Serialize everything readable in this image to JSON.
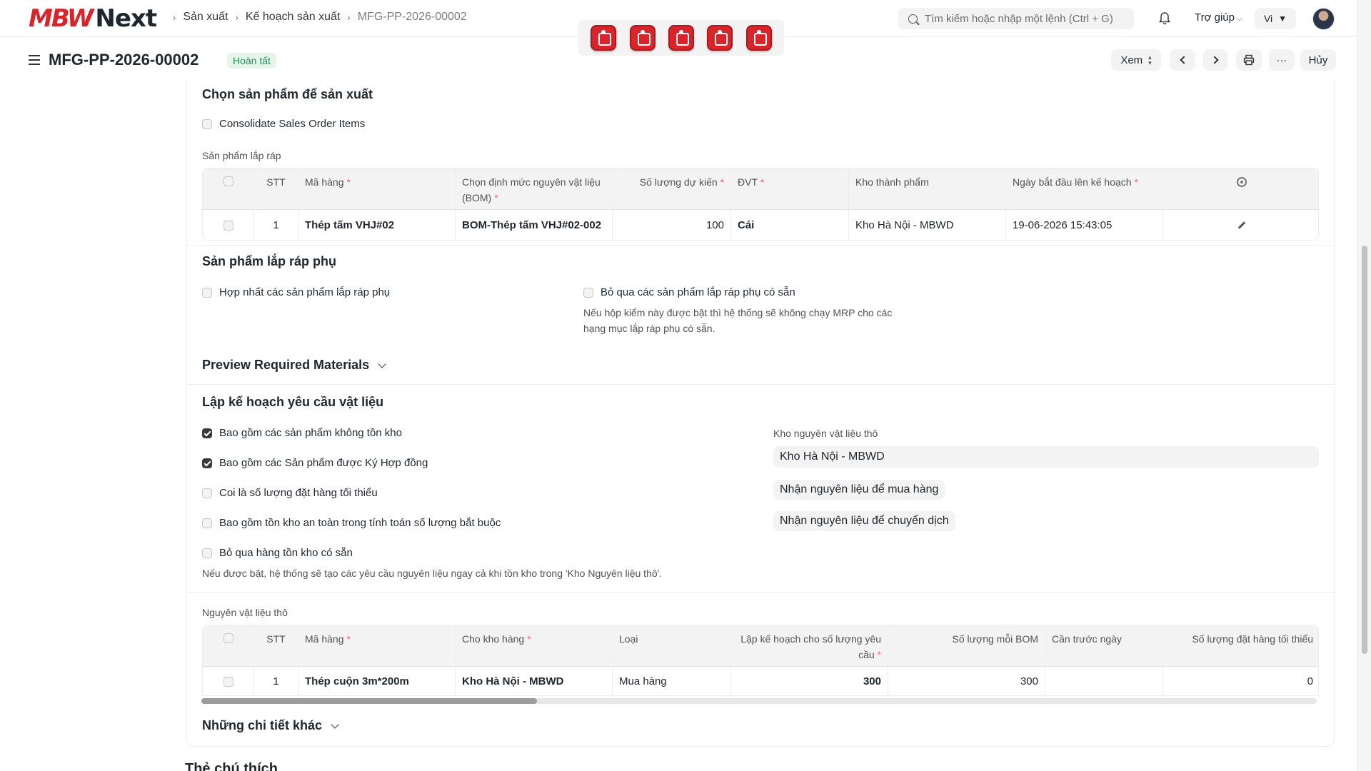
{
  "navbar": {
    "logo_mbw": "MBW",
    "logo_next": "Next",
    "breadcrumbs": [
      "Sản xuất",
      "Kế hoạch sản xuất",
      "MFG-PP-2026-00002"
    ],
    "search_placeholder": "Tìm kiếm hoặc nhập một lệnh (Ctrl + G)",
    "help_label": "Trợ giúp",
    "lang_label": "Vi",
    "app_icons": [
      "app-icon-1",
      "app-icon-2",
      "app-icon-3",
      "app-icon-4",
      "app-icon-5"
    ]
  },
  "page": {
    "title": "MFG-PP-2026-00002",
    "status": "Hoàn tất",
    "view_label": "Xem",
    "more_label": "···",
    "cancel_label": "Hủy"
  },
  "select_items": {
    "title": "Chọn sản phẩm để sản xuất",
    "consolidate_label": "Consolidate Sales Order Items",
    "consolidate_checked": false,
    "table_label": "Sản phẩm lắp ráp",
    "columns": [
      "STT",
      "Mã hàng",
      "Chọn định mức nguyên vật liệu (BOM)",
      "Số lượng dự kiến",
      "ĐVT",
      "Kho thành phẩm",
      "Ngày bắt đầu lên kế hoạch"
    ],
    "rows": [
      {
        "idx": "1",
        "item_code": "Thép tấm VHJ#02",
        "bom": "BOM-Thép tấm VHJ#02-002",
        "planned_qty": "100",
        "uom": "Cái",
        "warehouse": "Kho Hà Nội - MBWD",
        "start_date": "19-06-2026 15:43:05"
      }
    ]
  },
  "sub_assembly": {
    "title": "Sản phẩm lắp ráp phụ",
    "combine_label": "Hợp nhất các sản phẩm lắp ráp phụ",
    "skip_label": "Bỏ qua các sản phẩm lắp ráp phụ có sẵn",
    "skip_desc_1": "Nếu hộp kiểm này được bật thì hệ thống sẽ không chạy MRP cho các",
    "skip_desc_2": "hạng mục lắp ráp phụ có sẵn."
  },
  "preview": {
    "title": "Preview Required Materials"
  },
  "material_request": {
    "title": "Lập kế hoạch yêu cầu vật liệu",
    "options": [
      {
        "label": "Bao gồm các sản phẩm không tồn kho",
        "checked": true
      },
      {
        "label": "Bao gồm các Sản phẩm được Ký Hợp đồng",
        "checked": true
      },
      {
        "label": "Coi là số lượng đặt hàng tối thiểu",
        "checked": false
      },
      {
        "label": "Bao gồm tồn kho an toàn trong tính toán số lượng bắt buộc",
        "checked": false
      },
      {
        "label": "Bỏ qua hàng tồn kho có sẵn",
        "checked": false
      }
    ],
    "ignore_desc": "Nếu được bật, hệ thống sẽ tạo các yêu cầu nguyên liệu ngay cả khi tồn kho trong 'Kho Nguyên liệu thô'.",
    "raw_warehouse_label": "Kho nguyên vật liệu thô",
    "raw_warehouse_value": "Kho Hà Nội - MBWD",
    "btn_purchase": "Nhận nguyên liệu để mua hàng",
    "btn_transfer": "Nhận nguyên liệu để chuyển dịch"
  },
  "raw_materials": {
    "table_label": "Nguyên vật liệu thô",
    "columns": [
      "STT",
      "Mã hàng",
      "Cho kho hàng",
      "Loại",
      "Lập kế hoạch cho số lượng yêu cầu",
      "Số lượng mỗi BOM",
      "Cần trước ngày",
      "Số lượng đặt hàng tối thiểu"
    ],
    "rows": [
      {
        "idx": "1",
        "item_code": "Thép cuộn 3m*200m",
        "warehouse": "Kho Hà Nội - MBWD",
        "type": "Mua hàng",
        "required_qty": "300",
        "qty_per_bom": "300",
        "schedule_date": "",
        "min_order_qty": "0"
      }
    ]
  },
  "other_details": {
    "title": "Những chi tiết khác"
  },
  "footer": {
    "next_section_title": "Thẻ chú thích"
  },
  "colors": {
    "brand_red": "#d7252b",
    "status_green": "#278f5e",
    "status_bg": "#e4f5e9"
  }
}
